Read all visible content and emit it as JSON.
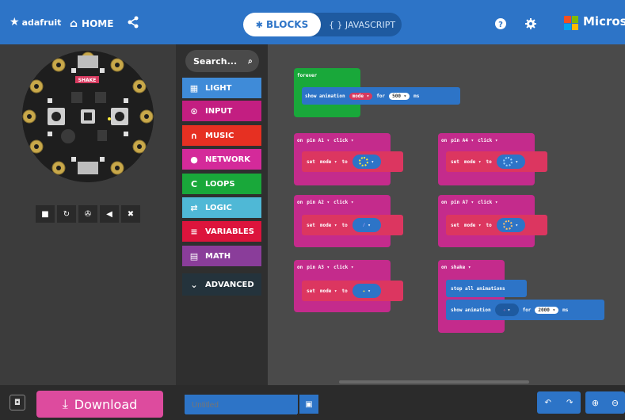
{
  "topbar": {
    "logo_text": "adafruit",
    "home_label": "HOME",
    "blocks_label": "BLOCKS",
    "javascript_label": "{ } JAVASCRIPT",
    "brand_text": "Microso",
    "ms_colors": [
      "#f25022",
      "#7fba00",
      "#00a4ef",
      "#ffb900"
    ],
    "accent": "#2d74c7"
  },
  "simulator": {
    "board_label": "SHAKE",
    "tools": [
      "stop-icon",
      "restart-icon",
      "slowmo-icon",
      "mute-icon",
      "fullscreen-icon"
    ]
  },
  "toolbox": {
    "search_placeholder": "Search...",
    "categories": [
      {
        "label": "LIGHT",
        "color": "#3f8bd8",
        "icon": "grid-icon"
      },
      {
        "label": "INPUT",
        "color": "#c31e81",
        "icon": "target-icon"
      },
      {
        "label": "MUSIC",
        "color": "#e63022",
        "icon": "headphones-icon"
      },
      {
        "label": "NETWORK",
        "color": "#d42a9a",
        "icon": "chat-icon"
      },
      {
        "label": "LOOPS",
        "color": "#19a83a",
        "icon": "loop-icon"
      },
      {
        "label": "LOGIC",
        "color": "#4fb8d6",
        "icon": "shuffle-icon"
      },
      {
        "label": "VARIABLES",
        "color": "#dc143c",
        "icon": "list-icon"
      },
      {
        "label": "MATH",
        "color": "#8a3d9a",
        "icon": "calculator-icon"
      },
      {
        "label": "ADVANCED",
        "color": "#24333c",
        "icon": "chevron-down-icon"
      }
    ]
  },
  "workspace": {
    "forever_block": {
      "hat": "forever",
      "show": "show animation",
      "var": "mode ▾",
      "for": "for",
      "value": "500 ▾",
      "unit": "ms"
    },
    "pin_blocks": [
      {
        "hat_on": "on",
        "pin": "pin A1 ▾",
        "event": "click ▾",
        "set": "set",
        "var": "mode ▾",
        "to": "to"
      },
      {
        "hat_on": "on",
        "pin": "pin A2 ▾",
        "event": "click ▾",
        "set": "set",
        "var": "mode ▾",
        "to": "to"
      },
      {
        "hat_on": "on",
        "pin": "pin A3 ▾",
        "event": "click ▾",
        "set": "set",
        "var": "mode ▾",
        "to": "to"
      },
      {
        "hat_on": "on",
        "pin": "pin A4 ▾",
        "event": "click ▾",
        "set": "set",
        "var": "mode ▾",
        "to": "to"
      },
      {
        "hat_on": "on",
        "pin": "pin A7 ▾",
        "event": "click ▾",
        "set": "set",
        "var": "mode ▾",
        "to": "to"
      }
    ],
    "shake_block": {
      "on": "on",
      "event": "shake ▾",
      "stop": "stop all animations",
      "show": "show animation",
      "for": "for",
      "value": "2000 ▾",
      "unit": "ms"
    }
  },
  "footer": {
    "download_label": "Download",
    "project_placeholder": "Untitled"
  }
}
